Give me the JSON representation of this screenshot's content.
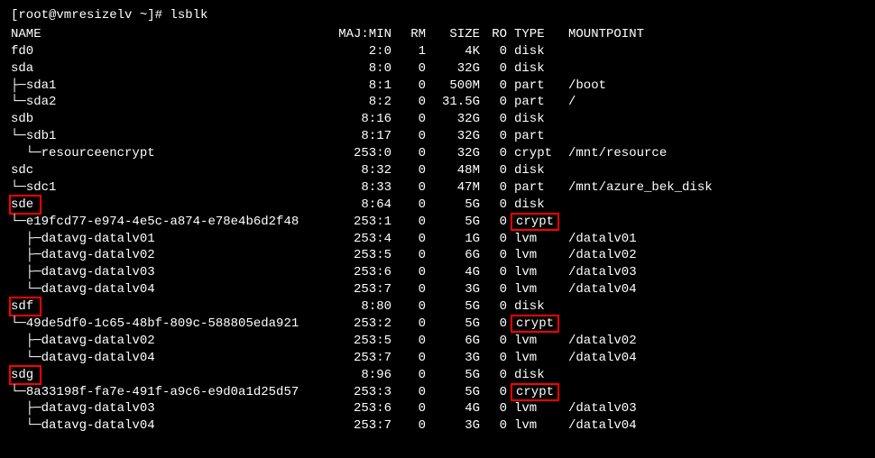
{
  "prompt": "[root@vmresizelv ~]# lsblk",
  "headers": {
    "name": "NAME",
    "majmin": "MAJ:MIN",
    "rm": "RM",
    "size": "SIZE",
    "ro": "RO",
    "type": "TYPE",
    "mount": "MOUNTPOINT"
  },
  "rows": [
    {
      "prefix": "",
      "name": "fd0",
      "maj": "2:0",
      "rm": "1",
      "size": "4K",
      "ro": "0",
      "type": "disk",
      "mount": "",
      "hl_name": false,
      "hl_type": false
    },
    {
      "prefix": "",
      "name": "sda",
      "maj": "8:0",
      "rm": "0",
      "size": "32G",
      "ro": "0",
      "type": "disk",
      "mount": "",
      "hl_name": false,
      "hl_type": false
    },
    {
      "prefix": "├─",
      "name": "sda1",
      "maj": "8:1",
      "rm": "0",
      "size": "500M",
      "ro": "0",
      "type": "part",
      "mount": "/boot",
      "hl_name": false,
      "hl_type": false
    },
    {
      "prefix": "└─",
      "name": "sda2",
      "maj": "8:2",
      "rm": "0",
      "size": "31.5G",
      "ro": "0",
      "type": "part",
      "mount": "/",
      "hl_name": false,
      "hl_type": false
    },
    {
      "prefix": "",
      "name": "sdb",
      "maj": "8:16",
      "rm": "0",
      "size": "32G",
      "ro": "0",
      "type": "disk",
      "mount": "",
      "hl_name": false,
      "hl_type": false
    },
    {
      "prefix": "└─",
      "name": "sdb1",
      "maj": "8:17",
      "rm": "0",
      "size": "32G",
      "ro": "0",
      "type": "part",
      "mount": "",
      "hl_name": false,
      "hl_type": false
    },
    {
      "prefix": "  └─",
      "name": "resourceencrypt",
      "maj": "253:0",
      "rm": "0",
      "size": "32G",
      "ro": "0",
      "type": "crypt",
      "mount": "/mnt/resource",
      "hl_name": false,
      "hl_type": false
    },
    {
      "prefix": "",
      "name": "sdc",
      "maj": "8:32",
      "rm": "0",
      "size": "48M",
      "ro": "0",
      "type": "disk",
      "mount": "",
      "hl_name": false,
      "hl_type": false
    },
    {
      "prefix": "└─",
      "name": "sdc1",
      "maj": "8:33",
      "rm": "0",
      "size": "47M",
      "ro": "0",
      "type": "part",
      "mount": "/mnt/azure_bek_disk",
      "hl_name": false,
      "hl_type": false
    },
    {
      "prefix": "",
      "name": "sde",
      "maj": "8:64",
      "rm": "0",
      "size": "5G",
      "ro": "0",
      "type": "disk",
      "mount": "",
      "hl_name": true,
      "hl_type": false
    },
    {
      "prefix": "└─",
      "name": "e19fcd77-e974-4e5c-a874-e78e4b6d2f48",
      "maj": "253:1",
      "rm": "0",
      "size": "5G",
      "ro": "0",
      "type": "crypt",
      "mount": "",
      "hl_name": false,
      "hl_type": true
    },
    {
      "prefix": "  ├─",
      "name": "datavg-datalv01",
      "maj": "253:4",
      "rm": "0",
      "size": "1G",
      "ro": "0",
      "type": "lvm",
      "mount": "/datalv01",
      "hl_name": false,
      "hl_type": false
    },
    {
      "prefix": "  ├─",
      "name": "datavg-datalv02",
      "maj": "253:5",
      "rm": "0",
      "size": "6G",
      "ro": "0",
      "type": "lvm",
      "mount": "/datalv02",
      "hl_name": false,
      "hl_type": false
    },
    {
      "prefix": "  ├─",
      "name": "datavg-datalv03",
      "maj": "253:6",
      "rm": "0",
      "size": "4G",
      "ro": "0",
      "type": "lvm",
      "mount": "/datalv03",
      "hl_name": false,
      "hl_type": false
    },
    {
      "prefix": "  └─",
      "name": "datavg-datalv04",
      "maj": "253:7",
      "rm": "0",
      "size": "3G",
      "ro": "0",
      "type": "lvm",
      "mount": "/datalv04",
      "hl_name": false,
      "hl_type": false
    },
    {
      "prefix": "",
      "name": "sdf",
      "maj": "8:80",
      "rm": "0",
      "size": "5G",
      "ro": "0",
      "type": "disk",
      "mount": "",
      "hl_name": true,
      "hl_type": false
    },
    {
      "prefix": "└─",
      "name": "49de5df0-1c65-48bf-809c-588805eda921",
      "maj": "253:2",
      "rm": "0",
      "size": "5G",
      "ro": "0",
      "type": "crypt",
      "mount": "",
      "hl_name": false,
      "hl_type": true
    },
    {
      "prefix": "  ├─",
      "name": "datavg-datalv02",
      "maj": "253:5",
      "rm": "0",
      "size": "6G",
      "ro": "0",
      "type": "lvm",
      "mount": "/datalv02",
      "hl_name": false,
      "hl_type": false
    },
    {
      "prefix": "  └─",
      "name": "datavg-datalv04",
      "maj": "253:7",
      "rm": "0",
      "size": "3G",
      "ro": "0",
      "type": "lvm",
      "mount": "/datalv04",
      "hl_name": false,
      "hl_type": false
    },
    {
      "prefix": "",
      "name": "sdg",
      "maj": "8:96",
      "rm": "0",
      "size": "5G",
      "ro": "0",
      "type": "disk",
      "mount": "",
      "hl_name": true,
      "hl_type": false
    },
    {
      "prefix": "└─",
      "name": "8a33198f-fa7e-491f-a9c6-e9d0a1d25d57",
      "maj": "253:3",
      "rm": "0",
      "size": "5G",
      "ro": "0",
      "type": "crypt",
      "mount": "",
      "hl_name": false,
      "hl_type": true
    },
    {
      "prefix": "  ├─",
      "name": "datavg-datalv03",
      "maj": "253:6",
      "rm": "0",
      "size": "4G",
      "ro": "0",
      "type": "lvm",
      "mount": "/datalv03",
      "hl_name": false,
      "hl_type": false
    },
    {
      "prefix": "  └─",
      "name": "datavg-datalv04",
      "maj": "253:7",
      "rm": "0",
      "size": "3G",
      "ro": "0",
      "type": "lvm",
      "mount": "/datalv04",
      "hl_name": false,
      "hl_type": false
    }
  ]
}
